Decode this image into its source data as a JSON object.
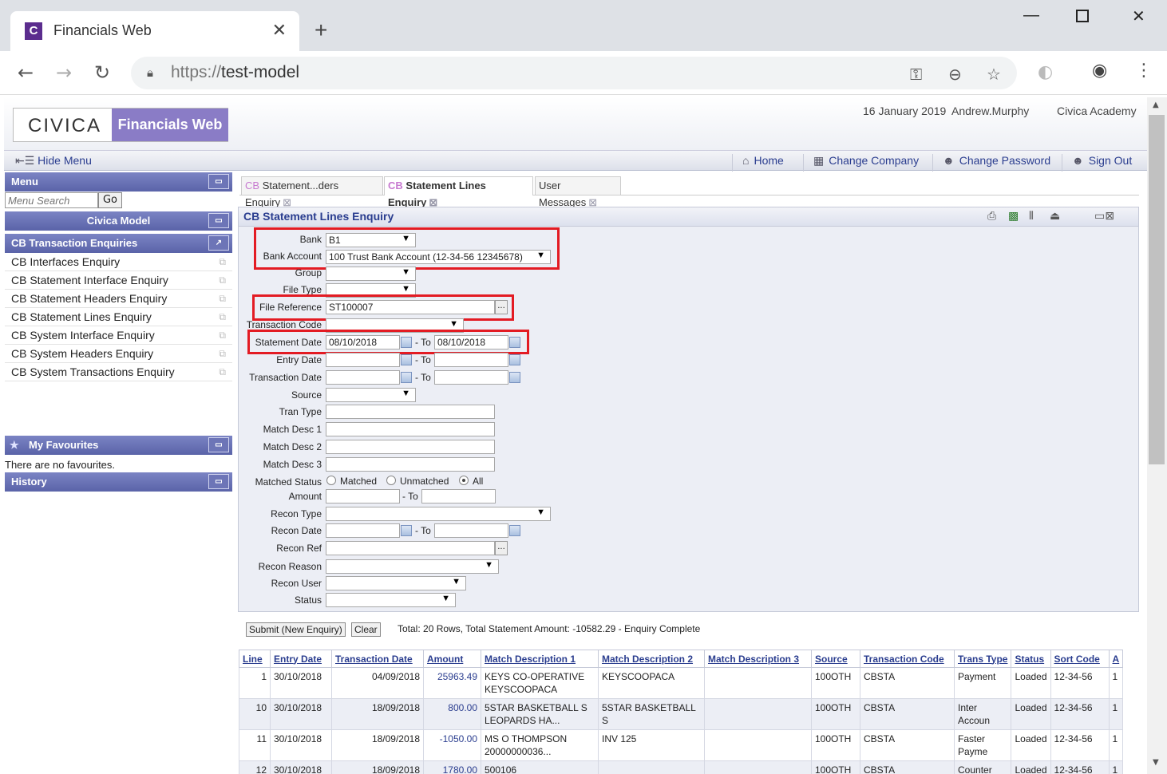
{
  "browser": {
    "tab_title": "Financials Web",
    "tab_logo": "C",
    "url_scheme": "https://",
    "url_host": "test-model"
  },
  "header": {
    "brand_civica": "CIVICA",
    "brand_product": "Financials Web",
    "date": "16 January 2019",
    "user": "Andrew.Murphy",
    "company": "Civica Academy"
  },
  "toolbar": {
    "hide_menu": "Hide Menu",
    "home": "Home",
    "change_company": "Change Company",
    "change_password": "Change Password",
    "sign_out": "Sign Out"
  },
  "sidebar": {
    "menu_title": "Menu",
    "search_placeholder": "Menu Search",
    "go": "Go",
    "model_title": "Civica Model",
    "section_title": "CB Transaction Enquiries",
    "items": [
      "CB Interfaces Enquiry",
      "CB Statement Interface Enquiry",
      "CB Statement Headers Enquiry",
      "CB Statement Lines Enquiry",
      "CB System Interface Enquiry",
      "CB System Headers Enquiry",
      "CB System Transactions Enquiry"
    ],
    "favourites_title": "My Favourites",
    "favourites_empty": "There are no favourites.",
    "history_title": "History"
  },
  "tabs": [
    {
      "prefix": "CB",
      "label": "Statement...ders Enquiry"
    },
    {
      "prefix": "CB",
      "label": "Statement Lines Enquiry"
    },
    {
      "prefix": "",
      "label": "User Messages"
    }
  ],
  "panel": {
    "title": "CB Statement Lines Enquiry",
    "labels": {
      "bank": "Bank",
      "bank_account": "Bank Account",
      "group": "Group",
      "file_type": "File Type",
      "file_reference": "File Reference",
      "transaction_code": "Transaction Code",
      "statement_date": "Statement Date",
      "entry_date": "Entry Date",
      "transaction_date": "Transaction Date",
      "source": "Source",
      "tran_type": "Tran Type",
      "match_desc_1": "Match Desc 1",
      "match_desc_2": "Match Desc 2",
      "match_desc_3": "Match Desc 3",
      "matched_status": "Matched Status",
      "amount": "Amount",
      "recon_type": "Recon Type",
      "recon_date": "Recon Date",
      "recon_ref": "Recon Ref",
      "recon_reason": "Recon Reason",
      "recon_user": "Recon User",
      "status": "Status",
      "to": "- To"
    },
    "values": {
      "bank": "B1",
      "bank_account": "100 Trust Bank Account (12-34-56 12345678)",
      "file_reference": "ST100007",
      "statement_date_from": "08/10/2018",
      "statement_date_to": "08/10/2018"
    },
    "radio": {
      "matched": "Matched",
      "unmatched": "Unmatched",
      "all": "All"
    }
  },
  "actions": {
    "submit": "Submit (New Enquiry)",
    "clear": "Clear",
    "status": "Total: 20 Rows, Total Statement Amount: -10582.29 - Enquiry Complete"
  },
  "table": {
    "headers": [
      "Line",
      "Entry Date",
      "Transaction Date",
      "Amount",
      "Match Description 1",
      "Match Description 2",
      "Match Description 3",
      "Source",
      "Transaction Code",
      "Trans Type",
      "Status",
      "Sort Code",
      "A"
    ],
    "rows": [
      [
        "1",
        "30/10/2018",
        "04/09/2018",
        "25963.49",
        "KEYS CO-OPERATIVE KEYSCOOPACA",
        "KEYSCOOPACA",
        "",
        "100OTH",
        "CBSTA",
        "Payment",
        "Loaded",
        "12-34-56",
        "1"
      ],
      [
        "10",
        "30/10/2018",
        "18/09/2018",
        "800.00",
        "5STAR BASKETBALL S LEOPARDS HA...",
        "5STAR BASKETBALL S",
        "",
        "100OTH",
        "CBSTA",
        "Inter Accoun",
        "Loaded",
        "12-34-56",
        "1"
      ],
      [
        "11",
        "30/10/2018",
        "18/09/2018",
        "-1050.00",
        "MS O THOMPSON 20000000036...",
        "INV 125",
        "",
        "100OTH",
        "CBSTA",
        "Faster Payme",
        "Loaded",
        "12-34-56",
        "1"
      ],
      [
        "12",
        "30/10/2018",
        "18/09/2018",
        "1780.00",
        "500106",
        "",
        "",
        "100OTH",
        "CBSTA",
        "Counter",
        "Loaded",
        "12-34-56",
        "1"
      ]
    ]
  }
}
